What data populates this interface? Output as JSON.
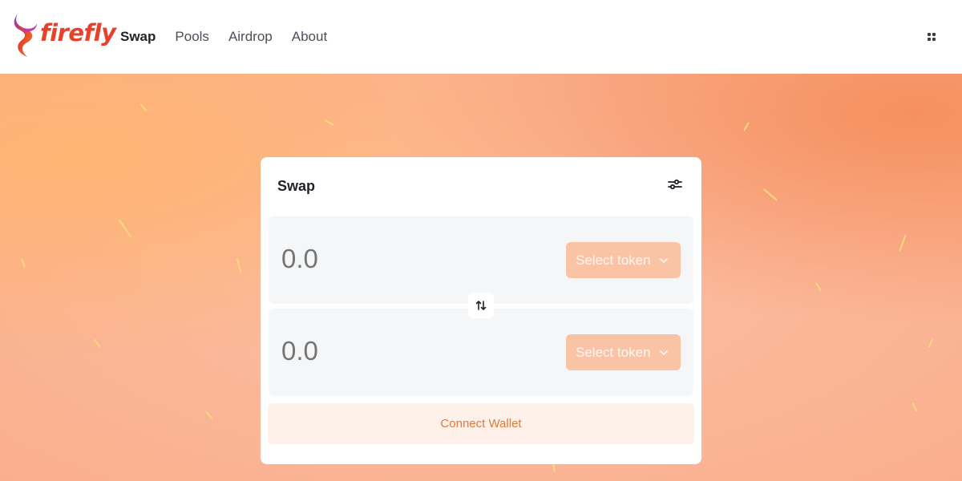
{
  "brand": {
    "name": "firefly",
    "colors": {
      "primary": "#e8402a",
      "accent": "#fbc3a5",
      "connect_text": "#e07a3c"
    }
  },
  "nav": {
    "items": [
      {
        "label": "Swap",
        "active": true
      },
      {
        "label": "Pools",
        "active": false
      },
      {
        "label": "Airdrop",
        "active": false
      },
      {
        "label": "About",
        "active": false
      }
    ],
    "menu_icon": "grid-dots-icon"
  },
  "swap": {
    "title": "Swap",
    "settings_icon": "settings-sliders-icon",
    "from": {
      "amount_placeholder": "0.0",
      "token_label": "Select token"
    },
    "to": {
      "amount_placeholder": "0.0",
      "token_label": "Select token"
    },
    "switch_icon": "swap-arrows-icon",
    "connect_label": "Connect Wallet"
  }
}
